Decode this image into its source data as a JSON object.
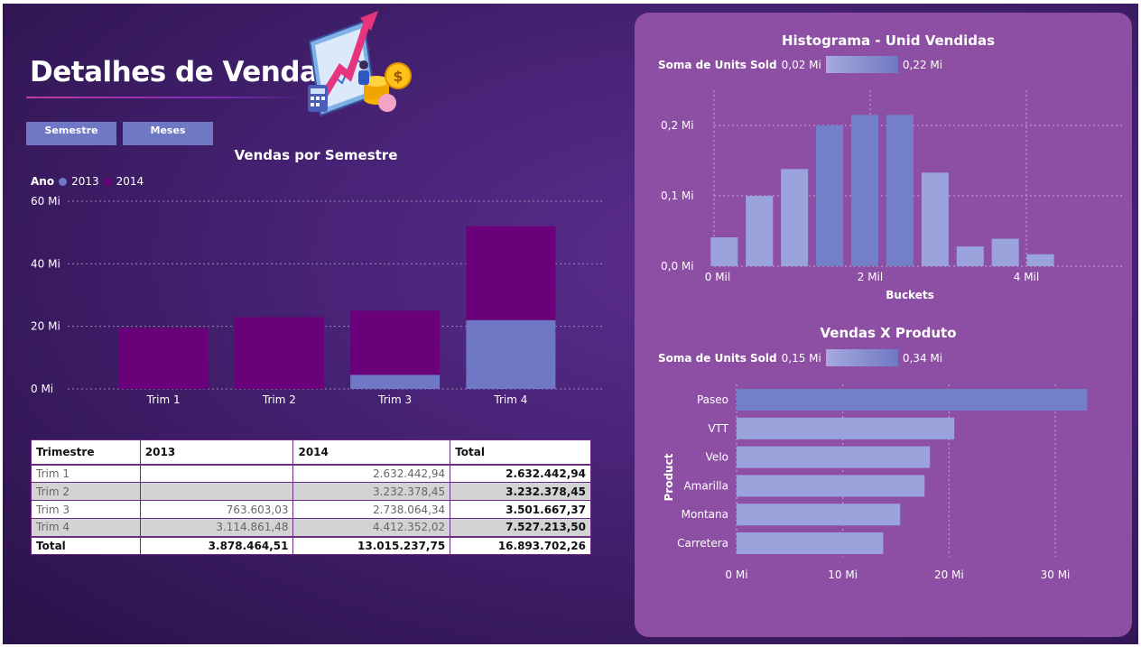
{
  "page": {
    "title": "Detalhes de Vendas",
    "buttons": {
      "semestre": "Semestre",
      "meses": "Meses"
    }
  },
  "colors": {
    "series_2013": "#6f78c4",
    "series_2014": "#6a007a",
    "hist_bar_light": "#9aa3db",
    "hist_bar_dark": "#737fc9",
    "panel": "#8d4fa3"
  },
  "illustration": {
    "icon": "growth-chart-coins-illustration"
  },
  "chart_data": [
    {
      "type": "bar",
      "stacked": true,
      "title": "Vendas por Semestre",
      "legend_title": "Ano",
      "legend_position": "top-left",
      "categories": [
        "Trim 1",
        "Trim 2",
        "Trim 3",
        "Trim 4"
      ],
      "series": [
        {
          "name": "2013",
          "values": [
            0,
            0,
            0.76,
            3.11
          ]
        },
        {
          "name": "2014",
          "values": [
            2.63,
            3.23,
            2.74,
            4.41
          ]
        }
      ],
      "display_values": {
        "2013": [
          0,
          0,
          4.5,
          22
        ],
        "2014": [
          19.5,
          23,
          20.5,
          30
        ]
      },
      "ylim": [
        0,
        60
      ],
      "yticks": [
        "0 Mi",
        "20 Mi",
        "40 Mi",
        "60 Mi"
      ],
      "grid": true
    },
    {
      "type": "bar",
      "title": "Histograma - Unid Vendidas",
      "gradient_legend": {
        "label": "Soma de Units Sold",
        "min": "0,02 Mi",
        "max": "0,22 Mi"
      },
      "xlabel": "Buckets",
      "x": [
        200,
        650,
        1100,
        1550,
        2000,
        2450,
        2900,
        3350,
        3800,
        4250
      ],
      "values": [
        0.041,
        0.1,
        0.138,
        0.2,
        0.215,
        0.215,
        0.133,
        0.028,
        0.039,
        0.017
      ],
      "xlim": [
        0,
        5000
      ],
      "ylim": [
        0,
        0.25
      ],
      "xticks": [
        "0 Mil",
        "2 Mil",
        "4 Mil"
      ],
      "yticks": [
        "0,0 Mi",
        "0,1 Mi",
        "0,2 Mi"
      ],
      "grid": true
    },
    {
      "type": "bar",
      "orientation": "horizontal",
      "title": "Vendas X Produto",
      "gradient_legend": {
        "label": "Soma de Units Sold",
        "min": "0,15 Mi",
        "max": "0,34 Mi"
      },
      "ylabel": "Product",
      "categories": [
        "Paseo",
        "VTT",
        "Velo",
        "Amarilla",
        "Montana",
        "Carretera"
      ],
      "values": [
        33,
        20.5,
        18.2,
        17.7,
        15.4,
        13.8
      ],
      "xlim": [
        0,
        35
      ],
      "xticks": [
        "0 Mi",
        "10 Mi",
        "20 Mi",
        "30 Mi"
      ],
      "grid": true
    },
    {
      "type": "table",
      "columns": [
        "Trimestre",
        "2013",
        "2014",
        "Total"
      ],
      "rows": [
        [
          "Trim 1",
          "",
          "2.632.442,94",
          "2.632.442,94"
        ],
        [
          "Trim 2",
          "",
          "3.232.378,45",
          "3.232.378,45"
        ],
        [
          "Trim 3",
          "763.603,03",
          "2.738.064,34",
          "3.501.667,37"
        ],
        [
          "Trim 4",
          "3.114.861,48",
          "4.412.352,02",
          "7.527.213,50"
        ]
      ],
      "total": [
        "Total",
        "3.878.464,51",
        "13.015.237,75",
        "16.893.702,26"
      ]
    }
  ]
}
